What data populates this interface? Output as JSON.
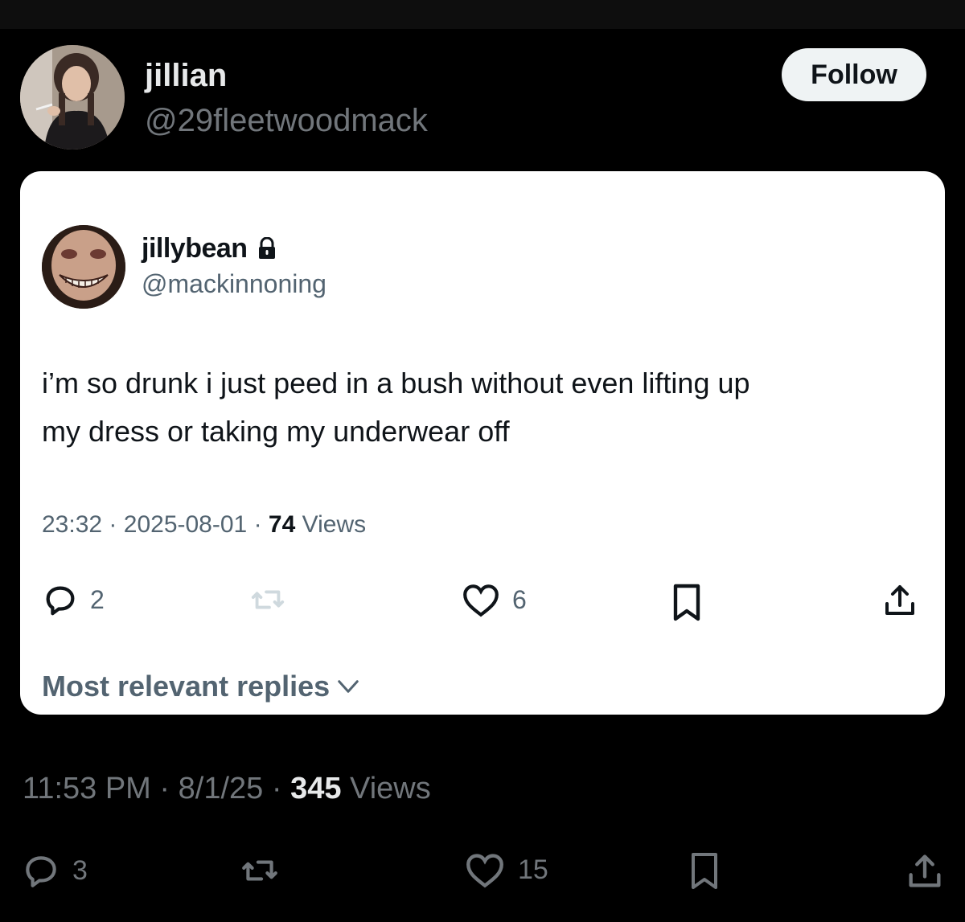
{
  "outer_tweet": {
    "author_name": "jillian",
    "author_handle": "@29fleetwoodmack",
    "follow_label": "Follow",
    "time": "11:53 PM",
    "date": "8/1/25",
    "views_count": "345",
    "views_label": "Views",
    "separator": "·",
    "reply_count": "3",
    "like_count": "15"
  },
  "quoted_screenshot": {
    "author_name": "jillybean",
    "author_handle": "@mackinnoning",
    "text_line1": "i’m so drunk i just peed in a bush without even lifting up",
    "text_line2": "my dress or taking my underwear off",
    "time": "23:32",
    "date": "2025-08-01",
    "views_count": "74",
    "views_label": "Views",
    "separator": "·",
    "reply_count": "2",
    "like_count": "6",
    "most_relevant_label": "Most relevant replies"
  },
  "colors": {
    "background": "#000000",
    "card": "#ffffff",
    "text_primary_dark": "#e7e9ea",
    "text_secondary_dark": "#71767b",
    "text_primary_light": "#0f1419",
    "text_secondary_light": "#536471",
    "retweet_disabled": "#cfd9de"
  },
  "icons": {
    "reply": "reply-icon",
    "retweet": "retweet-icon",
    "like": "heart-icon",
    "bookmark": "bookmark-icon",
    "share": "share-icon",
    "lock": "lock-icon",
    "chevron": "chevron-down-icon"
  }
}
